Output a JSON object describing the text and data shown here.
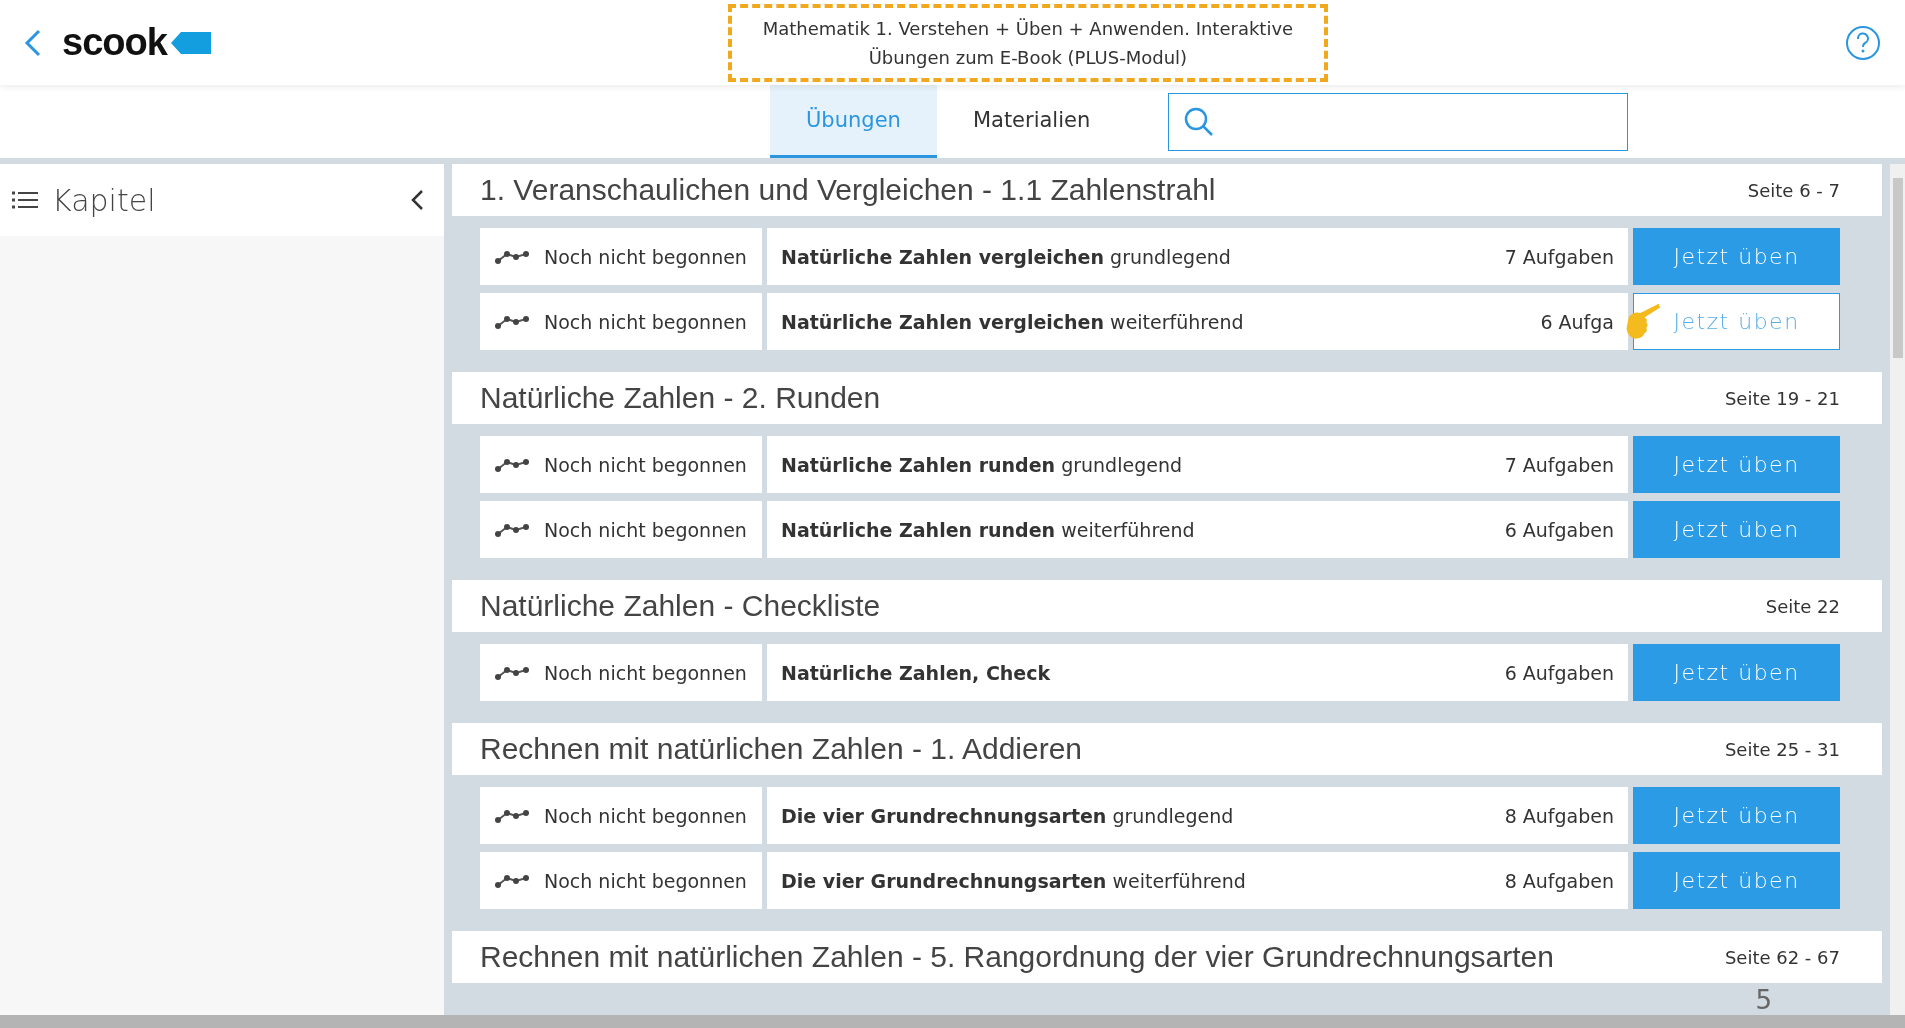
{
  "header": {
    "logo": "scook",
    "title": "Mathematik 1. Verstehen + Üben + Anwenden. Interaktive Übungen zum E-Book (PLUS-Modul)"
  },
  "tabs": [
    {
      "label": "Übungen",
      "selected": true
    },
    {
      "label": "Materialien",
      "selected": false
    }
  ],
  "sidebar": {
    "title": "Kapitel"
  },
  "sections": [
    {
      "title": "1. Veranschaulichen und Vergleichen - 1.1 Zahlenstrahl",
      "pages": "Seite 6 - 7",
      "rows": [
        {
          "status": "Noch nicht begonnen",
          "title_bold": "Natürliche Zahlen vergleichen",
          "title_rest": "grundlegend",
          "count": "7 Aufgaben",
          "button": "Jetzt üben",
          "highlighted": false
        },
        {
          "status": "Noch nicht begonnen",
          "title_bold": "Natürliche Zahlen vergleichen",
          "title_rest": "weiterführend",
          "count": "6 Aufga",
          "button": "Jetzt üben",
          "highlighted": true
        }
      ]
    },
    {
      "title": "Natürliche Zahlen - 2. Runden",
      "pages": "Seite 19 - 21",
      "rows": [
        {
          "status": "Noch nicht begonnen",
          "title_bold": "Natürliche Zahlen runden",
          "title_rest": "grundlegend",
          "count": "7 Aufgaben",
          "button": "Jetzt üben",
          "highlighted": false
        },
        {
          "status": "Noch nicht begonnen",
          "title_bold": "Natürliche Zahlen runden",
          "title_rest": "weiterführend",
          "count": "6 Aufgaben",
          "button": "Jetzt üben",
          "highlighted": false
        }
      ]
    },
    {
      "title": "Natürliche Zahlen - Checkliste",
      "pages": "Seite 22",
      "rows": [
        {
          "status": "Noch nicht begonnen",
          "title_bold": "Natürliche Zahlen, Check",
          "count": "6 Aufgaben",
          "button": "Jetzt üben",
          "highlighted": false
        }
      ]
    },
    {
      "title": "Rechnen mit natürlichen Zahlen - 1. Addieren",
      "pages": "Seite 25 - 31",
      "rows": [
        {
          "status": "Noch nicht begonnen",
          "title_bold": "Die vier Grundrechnungsarten",
          "title_rest": "grundlegend",
          "count": "8 Aufgaben",
          "button": "Jetzt üben",
          "highlighted": false
        },
        {
          "status": "Noch nicht begonnen",
          "title_bold": "Die vier Grundrechnungsarten",
          "title_rest": "weiterführend",
          "count": "8 Aufgaben",
          "button": "Jetzt üben",
          "highlighted": false
        }
      ]
    },
    {
      "title": "Rechnen mit natürlichen Zahlen - 5. Rangordnung der vier Grundrechnungsarten",
      "pages": "Seite 62 - 67"
    }
  ],
  "page_marker": "5"
}
